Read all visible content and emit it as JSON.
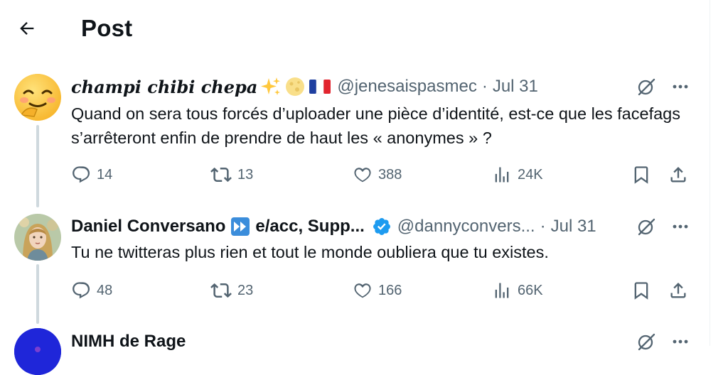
{
  "header": {
    "title": "Post"
  },
  "tweets": [
    {
      "name": "champi chibi chepa",
      "handle": "@jenesaispasmec",
      "date": "Jul 31",
      "text": "Quand on sera tous forcés d’uploader une pièce d’identité, est-ce que les facefags s’arrêteront enfin de prendre de haut les « anonymes » ?",
      "replies": "14",
      "reposts": "13",
      "likes": "388",
      "views": "24K",
      "name_emojis": [
        "sparkles-emoji",
        "full-moon-emoji",
        "france-flag-emoji"
      ]
    },
    {
      "name": "Daniel Conversano",
      "name_suffix": "e/acc, Supp...",
      "handle": "@dannyconvers...",
      "date": "Jul 31",
      "text": "Tu ne twitteras plus rien et tout le monde oubliera que tu existes.",
      "replies": "48",
      "reposts": "23",
      "likes": "166",
      "views": "66K",
      "verified": true
    },
    {
      "name": "NIMH de Rage"
    }
  ],
  "dot_separator": "·",
  "colors": {
    "text_primary": "#0f1419",
    "text_secondary": "#536471",
    "thread_line": "#cfd9de",
    "verified_blue": "#1d9bf0"
  }
}
